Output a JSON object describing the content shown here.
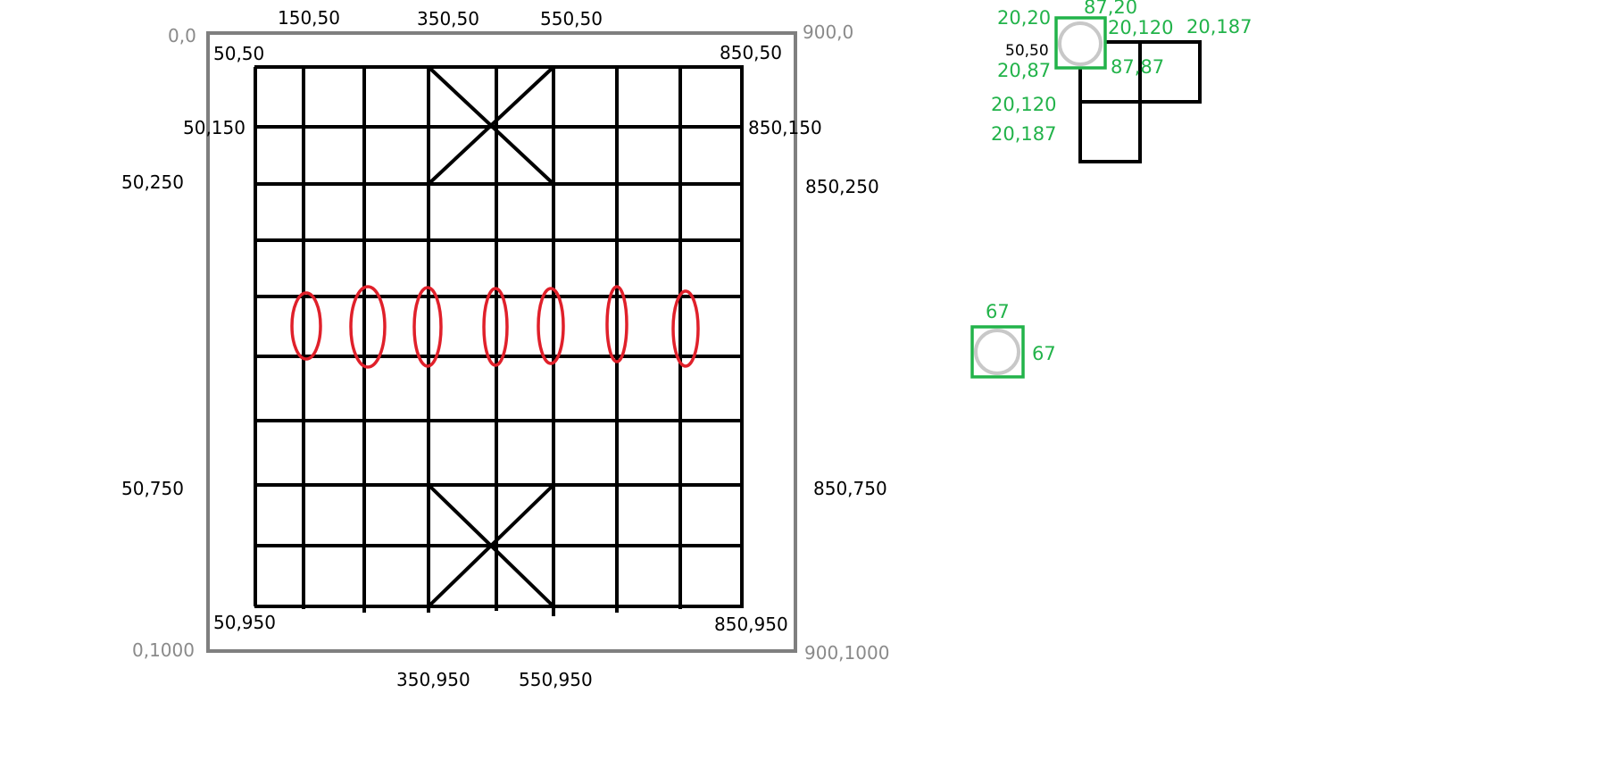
{
  "board": {
    "outer_corners": {
      "top_left": "0,0",
      "top_right": "900,0",
      "bottom_left": "0,1000",
      "bottom_right": "900,1000"
    },
    "grid_labels": {
      "top_left": "50,50",
      "top_right": "850,50",
      "bottom_left": "50,950",
      "bottom_right": "850,950",
      "top_150": "150,50",
      "top_350": "350,50",
      "top_550": "550,50",
      "left_150": "50,150",
      "left_250": "50,250",
      "left_750": "50,750",
      "right_150": "850,150",
      "right_250": "850,250",
      "right_750": "850,750",
      "bottom_350": "350,950",
      "bottom_550": "550,950"
    },
    "line_color": "#000000",
    "frame_color": "#7f7f7f",
    "river_marker_color": "#e0202a",
    "river_marker_count": 7
  },
  "piece_detail": {
    "labels": {
      "p_20_20": "20,20",
      "p_87_20": "87,20",
      "p_20_120_top": "20,120",
      "p_20_187_top": "20,187",
      "p_50_50": "50,50",
      "p_20_87": "20,87",
      "p_87_87": "87,87",
      "p_20_120_left": "20,120",
      "p_20_187_left": "20,187"
    },
    "accent_color": "#22b34a",
    "circle_color": "#c8c8c8"
  },
  "piece_size": {
    "width_label": "67",
    "height_label": "67"
  }
}
